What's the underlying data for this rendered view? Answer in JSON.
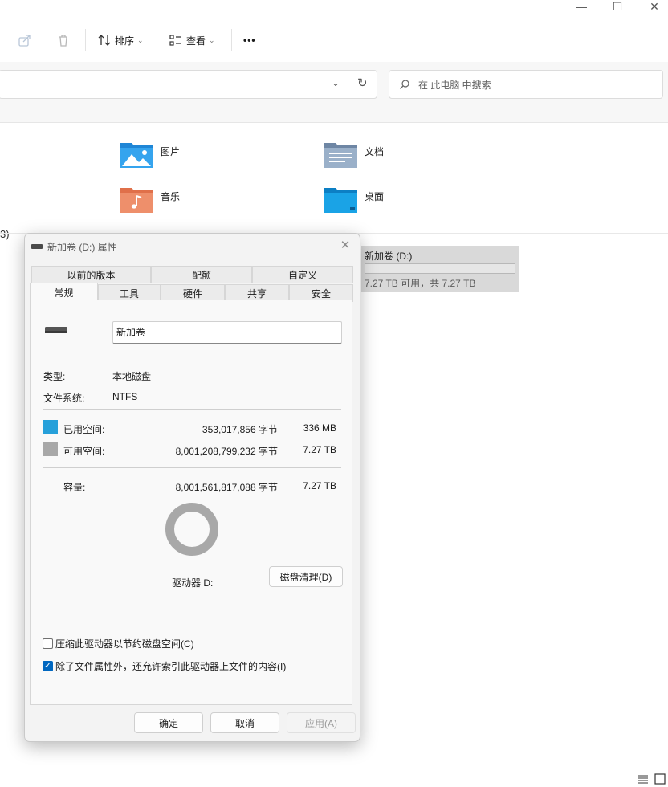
{
  "explorer": {
    "window_controls": {
      "minimize": "—",
      "maximize": "☐",
      "close": "✕"
    },
    "toolbar": {
      "sort_label": "排序",
      "view_label": "查看",
      "more_label": "•••"
    },
    "search": {
      "placeholder": "在 此电脑 中搜索"
    },
    "folders": [
      {
        "label": "图片",
        "icon": "pictures-folder-icon"
      },
      {
        "label": "文档",
        "icon": "documents-folder-icon"
      },
      {
        "label": "音乐",
        "icon": "music-folder-icon"
      },
      {
        "label": "桌面",
        "icon": "desktop-folder-icon"
      }
    ],
    "section_tail": "3)",
    "drive": {
      "name": "新加卷 (D:)",
      "free_text": "7.27 TB 可用，共 7.27 TB",
      "used_fraction": 0.0
    }
  },
  "dialog": {
    "title": "新加卷 (D:) 属性",
    "tabs_row1": [
      "以前的版本",
      "配额",
      "自定义"
    ],
    "tabs_row2": [
      "常规",
      "工具",
      "硬件",
      "共享",
      "安全"
    ],
    "active_tab": "常规",
    "volume_name": "新加卷",
    "type_label": "类型:",
    "type_value": "本地磁盘",
    "fs_label": "文件系统:",
    "fs_value": "NTFS",
    "used_label": "已用空间:",
    "used_bytes": "353,017,856 字节",
    "used_size": "336 MB",
    "free_label": "可用空间:",
    "free_bytes": "8,001,208,799,232 字节",
    "free_size": "7.27 TB",
    "capacity_label": "容量:",
    "capacity_bytes": "8,001,561,817,088 字节",
    "capacity_size": "7.27 TB",
    "drive_label": "驱动器 D:",
    "cleanup_button": "磁盘清理(D)",
    "compress_label": "压缩此驱动器以节约磁盘空间(C)",
    "compress_checked": false,
    "index_label": "除了文件属性外，还允许索引此驱动器上文件的内容(I)",
    "index_checked": true,
    "ok_button": "确定",
    "cancel_button": "取消",
    "apply_button": "应用(A)",
    "colors": {
      "used": "#26a0da",
      "free": "#a8a8a8",
      "accent": "#0067c0"
    }
  },
  "statusbar": {
    "details_icon": "details-view-icon",
    "tiles_icon": "tiles-view-icon"
  }
}
